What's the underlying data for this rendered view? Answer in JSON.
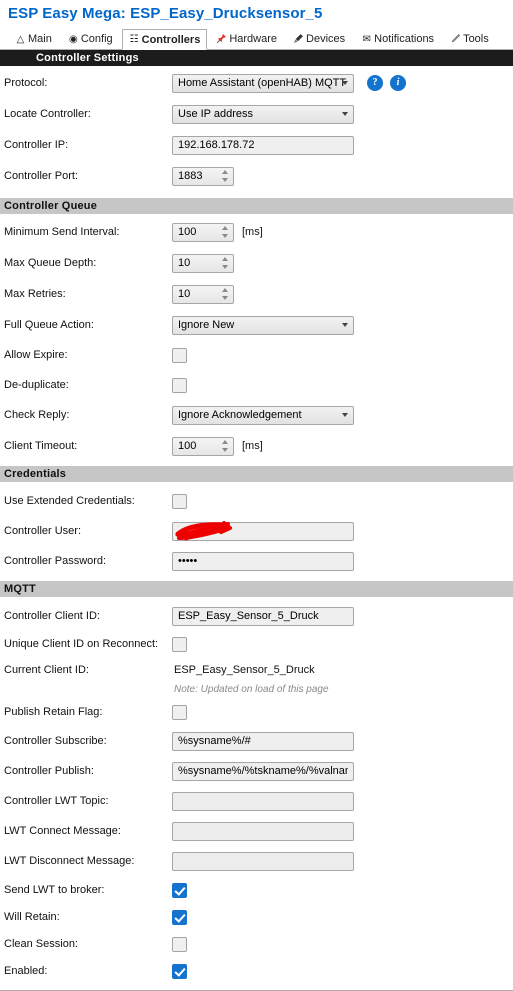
{
  "header": {
    "title": "ESP Easy Mega: ESP_Easy_Drucksensor_5"
  },
  "tabs": [
    {
      "label": "Main",
      "icon": "home-icon",
      "glyph": "⌂",
      "active": false
    },
    {
      "label": "Config",
      "icon": "gear-icon",
      "glyph": "⚙",
      "active": false
    },
    {
      "label": "Controllers",
      "icon": "controllers-icon",
      "glyph": "⌨",
      "active": true
    },
    {
      "label": "Hardware",
      "icon": "pushpin-icon",
      "glyph": "📌",
      "active": false
    },
    {
      "label": "Devices",
      "icon": "plug-icon",
      "glyph": "🔌",
      "active": false
    },
    {
      "label": "Notifications",
      "icon": "envelope-icon",
      "glyph": "✉",
      "active": false
    },
    {
      "label": "Tools",
      "icon": "pencil-icon",
      "glyph": "✎",
      "active": false
    }
  ],
  "sections": {
    "controller_settings": "Controller Settings",
    "controller_queue": "Controller Queue",
    "credentials": "Credentials",
    "mqtt": "MQTT"
  },
  "controller_settings": {
    "protocol": {
      "label": "Protocol:",
      "value": "Home Assistant (openHAB) MQTT",
      "help_icon": "?",
      "info_icon": "i"
    },
    "locate_controller": {
      "label": "Locate Controller:",
      "value": "Use IP address"
    },
    "controller_ip": {
      "label": "Controller IP:",
      "value": "192.168.178.72"
    },
    "controller_port": {
      "label": "Controller Port:",
      "value": "1883"
    }
  },
  "controller_queue": {
    "minimum_send_interval": {
      "label": "Minimum Send Interval:",
      "value": "100",
      "unit": "[ms]"
    },
    "max_queue_depth": {
      "label": "Max Queue Depth:",
      "value": "10"
    },
    "max_retries": {
      "label": "Max Retries:",
      "value": "10"
    },
    "full_queue_action": {
      "label": "Full Queue Action:",
      "value": "Ignore New"
    },
    "allow_expire": {
      "label": "Allow Expire:",
      "checked": false
    },
    "de_duplicate": {
      "label": "De-duplicate:",
      "checked": false
    },
    "check_reply": {
      "label": "Check Reply:",
      "value": "Ignore Acknowledgement"
    },
    "client_timeout": {
      "label": "Client Timeout:",
      "value": "100",
      "unit": "[ms]"
    }
  },
  "credentials": {
    "use_extended_credentials": {
      "label": "Use Extended Credentials:",
      "checked": false
    },
    "controller_user": {
      "label": "Controller User:",
      "value": "",
      "redacted": true
    },
    "controller_password": {
      "label": "Controller Password:",
      "value": "•••••"
    }
  },
  "mqtt": {
    "controller_client_id": {
      "label": "Controller Client ID:",
      "value": "ESP_Easy_Sensor_5_Druck"
    },
    "unique_client_id": {
      "label": "Unique Client ID on Reconnect:",
      "checked": false
    },
    "current_client_id": {
      "label": "Current Client ID:",
      "value": "ESP_Easy_Sensor_5_Druck"
    },
    "current_client_id_note": "Note: Updated on load of this page",
    "publish_retain_flag": {
      "label": "Publish Retain Flag:",
      "checked": false
    },
    "controller_subscribe": {
      "label": "Controller Subscribe:",
      "value": "%sysname%/#"
    },
    "controller_publish": {
      "label": "Controller Publish:",
      "value": "%sysname%/%tskname%/%valname"
    },
    "controller_lwt_topic": {
      "label": "Controller LWT Topic:",
      "value": ""
    },
    "lwt_connect_message": {
      "label": "LWT Connect Message:",
      "value": ""
    },
    "lwt_disconnect_message": {
      "label": "LWT Disconnect Message:",
      "value": ""
    },
    "send_lwt_to_broker": {
      "label": "Send LWT to broker:",
      "checked": true
    },
    "will_retain": {
      "label": "Will Retain:",
      "checked": true
    },
    "clean_session": {
      "label": "Clean Session:",
      "checked": false
    },
    "enabled": {
      "label": "Enabled:",
      "checked": true
    }
  },
  "colors": {
    "title": "#0066cc",
    "accent": "#1474cd",
    "section_dark": "#1c1c1c",
    "section_gray": "#c6c6c6",
    "redaction": "#ee0000"
  }
}
